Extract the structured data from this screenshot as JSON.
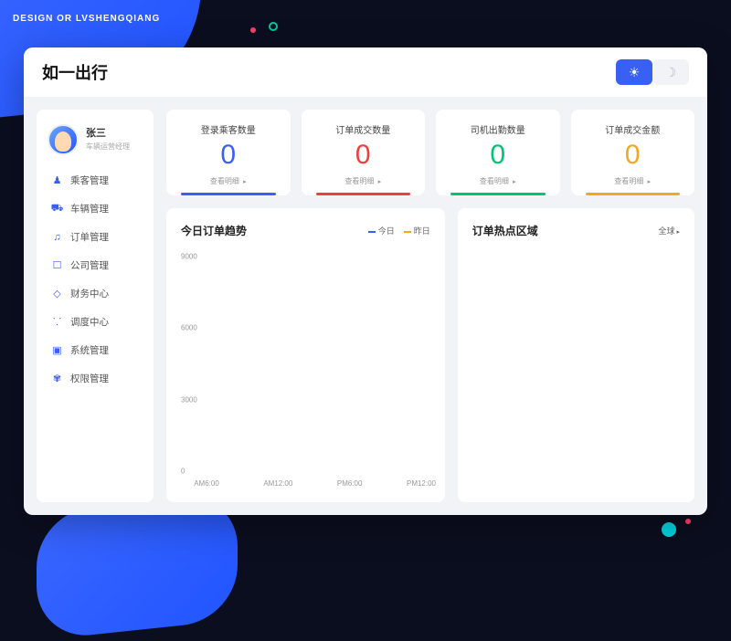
{
  "watermark": "DESIGN OR\nLVSHENGQIANG",
  "brand": "如一出行",
  "user": {
    "name": "张三",
    "role": "车辆运营经理"
  },
  "nav": [
    {
      "icon": "user-icon",
      "glyph": "♟",
      "label": "乘客管理"
    },
    {
      "icon": "car-icon",
      "glyph": "⛟",
      "label": "车辆管理"
    },
    {
      "icon": "order-icon",
      "glyph": "♫",
      "label": "订单管理"
    },
    {
      "icon": "company-icon",
      "glyph": "☐",
      "label": "公司管理"
    },
    {
      "icon": "finance-icon",
      "glyph": "◇",
      "label": "财务中心"
    },
    {
      "icon": "dispatch-icon",
      "glyph": "⸪",
      "label": "调度中心"
    },
    {
      "icon": "system-icon",
      "glyph": "▣",
      "label": "系统管理"
    },
    {
      "icon": "permission-icon",
      "glyph": "✾",
      "label": "权限管理"
    }
  ],
  "stats": [
    {
      "title": "登录乘客数量",
      "value": "0",
      "link": "查看明细",
      "color": "blue"
    },
    {
      "title": "订单成交数量",
      "value": "0",
      "link": "查看明细",
      "color": "red"
    },
    {
      "title": "司机出勤数量",
      "value": "0",
      "link": "查看明细",
      "color": "green"
    },
    {
      "title": "订单成交金额",
      "value": "0",
      "link": "查看明细",
      "color": "yellow"
    }
  ],
  "trend": {
    "title": "今日订单趋势",
    "legend": [
      {
        "label": "今日",
        "color": "#3860f5"
      },
      {
        "label": "昨日",
        "color": "#f5a623"
      }
    ]
  },
  "hotspot": {
    "title": "订单热点区域",
    "scope": "全球"
  },
  "chart_data": {
    "type": "line",
    "title": "今日订单趋势",
    "xlabel": "",
    "ylabel": "",
    "ylim": [
      0,
      9000
    ],
    "categories": [
      "AM6:00",
      "AM12:00",
      "PM6:00",
      "PM12:00"
    ],
    "y_ticks": [
      0,
      3000,
      6000,
      9000
    ],
    "series": [
      {
        "name": "今日",
        "values": [
          null,
          null,
          null,
          null
        ]
      },
      {
        "name": "昨日",
        "values": [
          null,
          null,
          null,
          null
        ]
      }
    ]
  }
}
